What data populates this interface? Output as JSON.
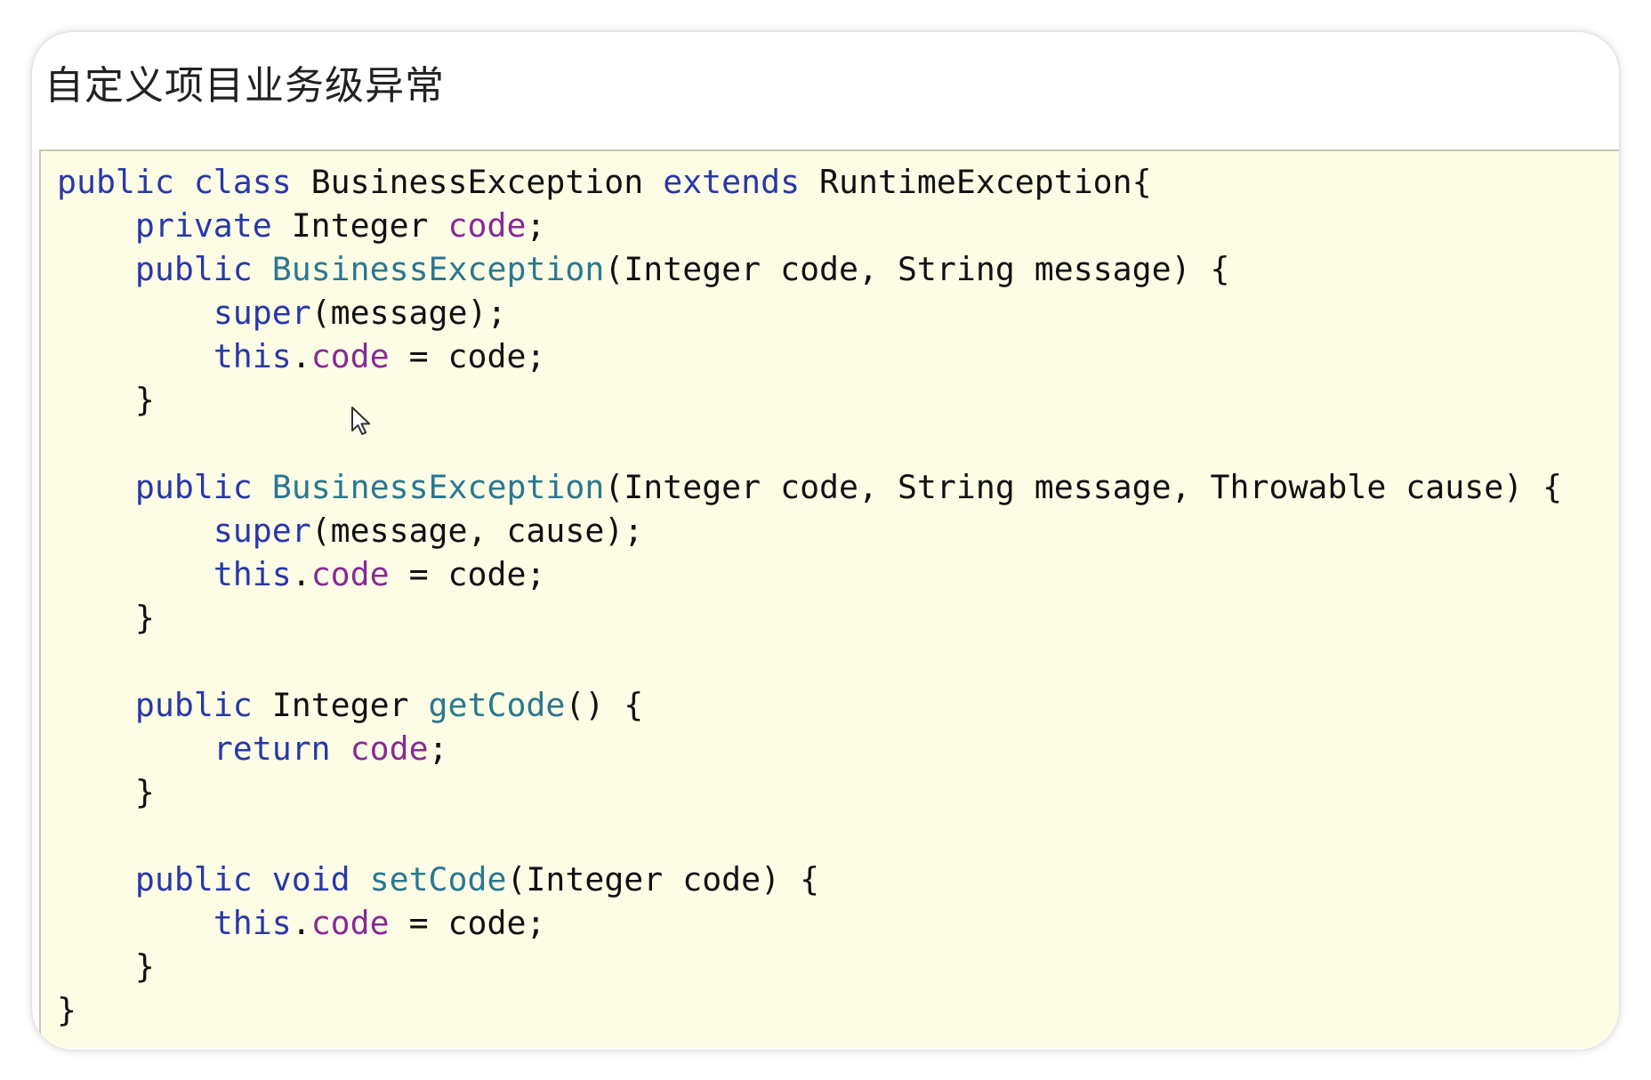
{
  "title": "自定义项目业务级异常",
  "code": {
    "lines": [
      [
        {
          "t": "public class",
          "c": "kw"
        },
        {
          "t": " BusinessException "
        },
        {
          "t": "extends",
          "c": "kw"
        },
        {
          "t": " RuntimeException{"
        }
      ],
      [
        {
          "t": "    "
        },
        {
          "t": "private",
          "c": "kw"
        },
        {
          "t": " Integer "
        },
        {
          "t": "code",
          "c": "fd"
        },
        {
          "t": ";"
        }
      ],
      [
        {
          "t": "    "
        },
        {
          "t": "public",
          "c": "kw"
        },
        {
          "t": " "
        },
        {
          "t": "BusinessException",
          "c": "fn"
        },
        {
          "t": "(Integer code, String message) {"
        }
      ],
      [
        {
          "t": "        "
        },
        {
          "t": "super",
          "c": "kw"
        },
        {
          "t": "(message);"
        }
      ],
      [
        {
          "t": "        "
        },
        {
          "t": "this",
          "c": "kw"
        },
        {
          "t": "."
        },
        {
          "t": "code",
          "c": "fd"
        },
        {
          "t": " = code;"
        }
      ],
      [
        {
          "t": "    }"
        }
      ],
      [],
      [
        {
          "t": "    "
        },
        {
          "t": "public",
          "c": "kw"
        },
        {
          "t": " "
        },
        {
          "t": "BusinessException",
          "c": "fn"
        },
        {
          "t": "(Integer code, String message, Throwable cause) {"
        }
      ],
      [
        {
          "t": "        "
        },
        {
          "t": "super",
          "c": "kw"
        },
        {
          "t": "(message, cause);"
        }
      ],
      [
        {
          "t": "        "
        },
        {
          "t": "this",
          "c": "kw"
        },
        {
          "t": "."
        },
        {
          "t": "code",
          "c": "fd"
        },
        {
          "t": " = code;"
        }
      ],
      [
        {
          "t": "    }"
        }
      ],
      [],
      [
        {
          "t": "    "
        },
        {
          "t": "public",
          "c": "kw"
        },
        {
          "t": " Integer "
        },
        {
          "t": "getCode",
          "c": "fn"
        },
        {
          "t": "() {"
        }
      ],
      [
        {
          "t": "        "
        },
        {
          "t": "return",
          "c": "kw"
        },
        {
          "t": " "
        },
        {
          "t": "code",
          "c": "fd"
        },
        {
          "t": ";"
        }
      ],
      [
        {
          "t": "    }"
        }
      ],
      [],
      [
        {
          "t": "    "
        },
        {
          "t": "public void",
          "c": "kw"
        },
        {
          "t": " "
        },
        {
          "t": "setCode",
          "c": "fn"
        },
        {
          "t": "(Integer code) {"
        }
      ],
      [
        {
          "t": "        "
        },
        {
          "t": "this",
          "c": "kw"
        },
        {
          "t": "."
        },
        {
          "t": "code",
          "c": "fd"
        },
        {
          "t": " = code;"
        }
      ],
      [
        {
          "t": "    }"
        }
      ],
      [
        {
          "t": "}"
        }
      ]
    ]
  },
  "colors": {
    "keyword": "#2838a8",
    "method": "#2a7890",
    "field": "#882a98",
    "code_background": "#fdfde6"
  },
  "icons": {
    "cursor": "mouse-pointer-icon"
  }
}
